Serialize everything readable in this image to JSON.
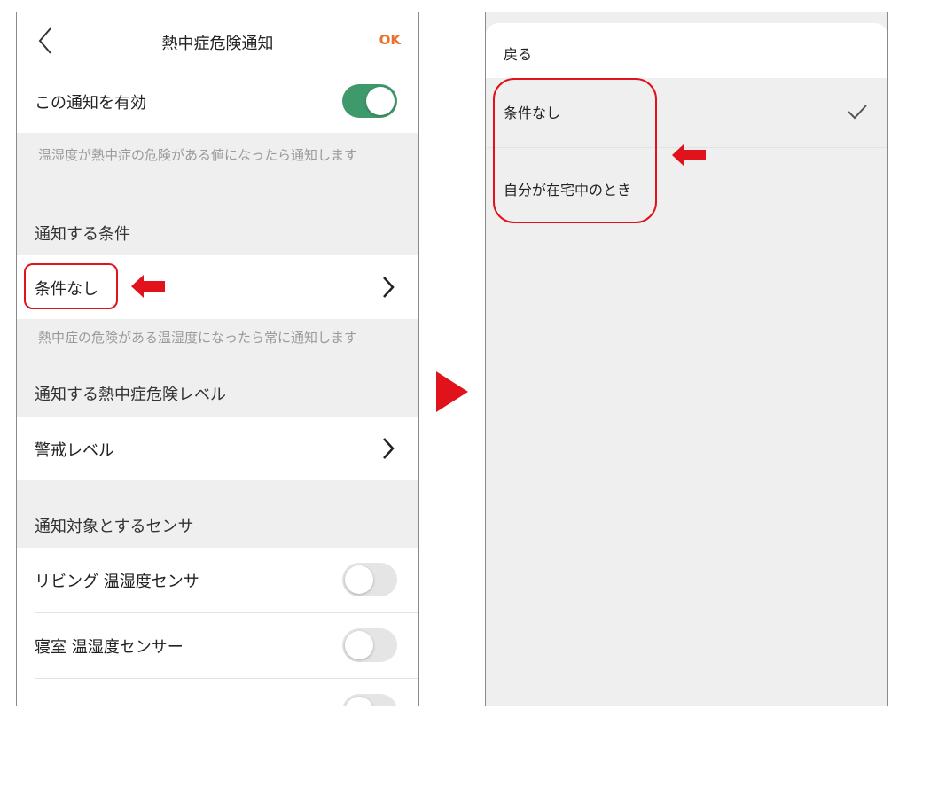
{
  "left": {
    "header": {
      "title": "熱中症危険通知",
      "ok_label": "OK"
    },
    "enable_row": {
      "label": "この通知を有効",
      "toggle_on": true
    },
    "enable_hint": "温湿度が熱中症の危険がある値になったら通知します",
    "condition_section": {
      "label": "通知する条件"
    },
    "condition_row": {
      "label": "条件なし"
    },
    "condition_hint": "熱中症の危険がある温湿度になったら常に通知します",
    "level_section": {
      "label": "通知する熱中症危険レベル"
    },
    "level_row": {
      "label": "警戒レベル"
    },
    "sensor_section": {
      "label": "通知対象とするセンサ"
    },
    "sensors": [
      {
        "label": "リビング 温湿度センサ",
        "toggle_on": false
      },
      {
        "label": "寝室 温湿度センサー",
        "toggle_on": false
      },
      {
        "label": "",
        "toggle_on": false
      }
    ]
  },
  "right": {
    "back_label": "戻る",
    "options": [
      {
        "label": "条件なし",
        "selected": true
      },
      {
        "label": "自分が在宅中のとき",
        "selected": false
      }
    ]
  },
  "colors": {
    "accent_ok": "#e8722c",
    "toggle_on": "#3e9a6a",
    "annotation_red": "#e0121b"
  }
}
